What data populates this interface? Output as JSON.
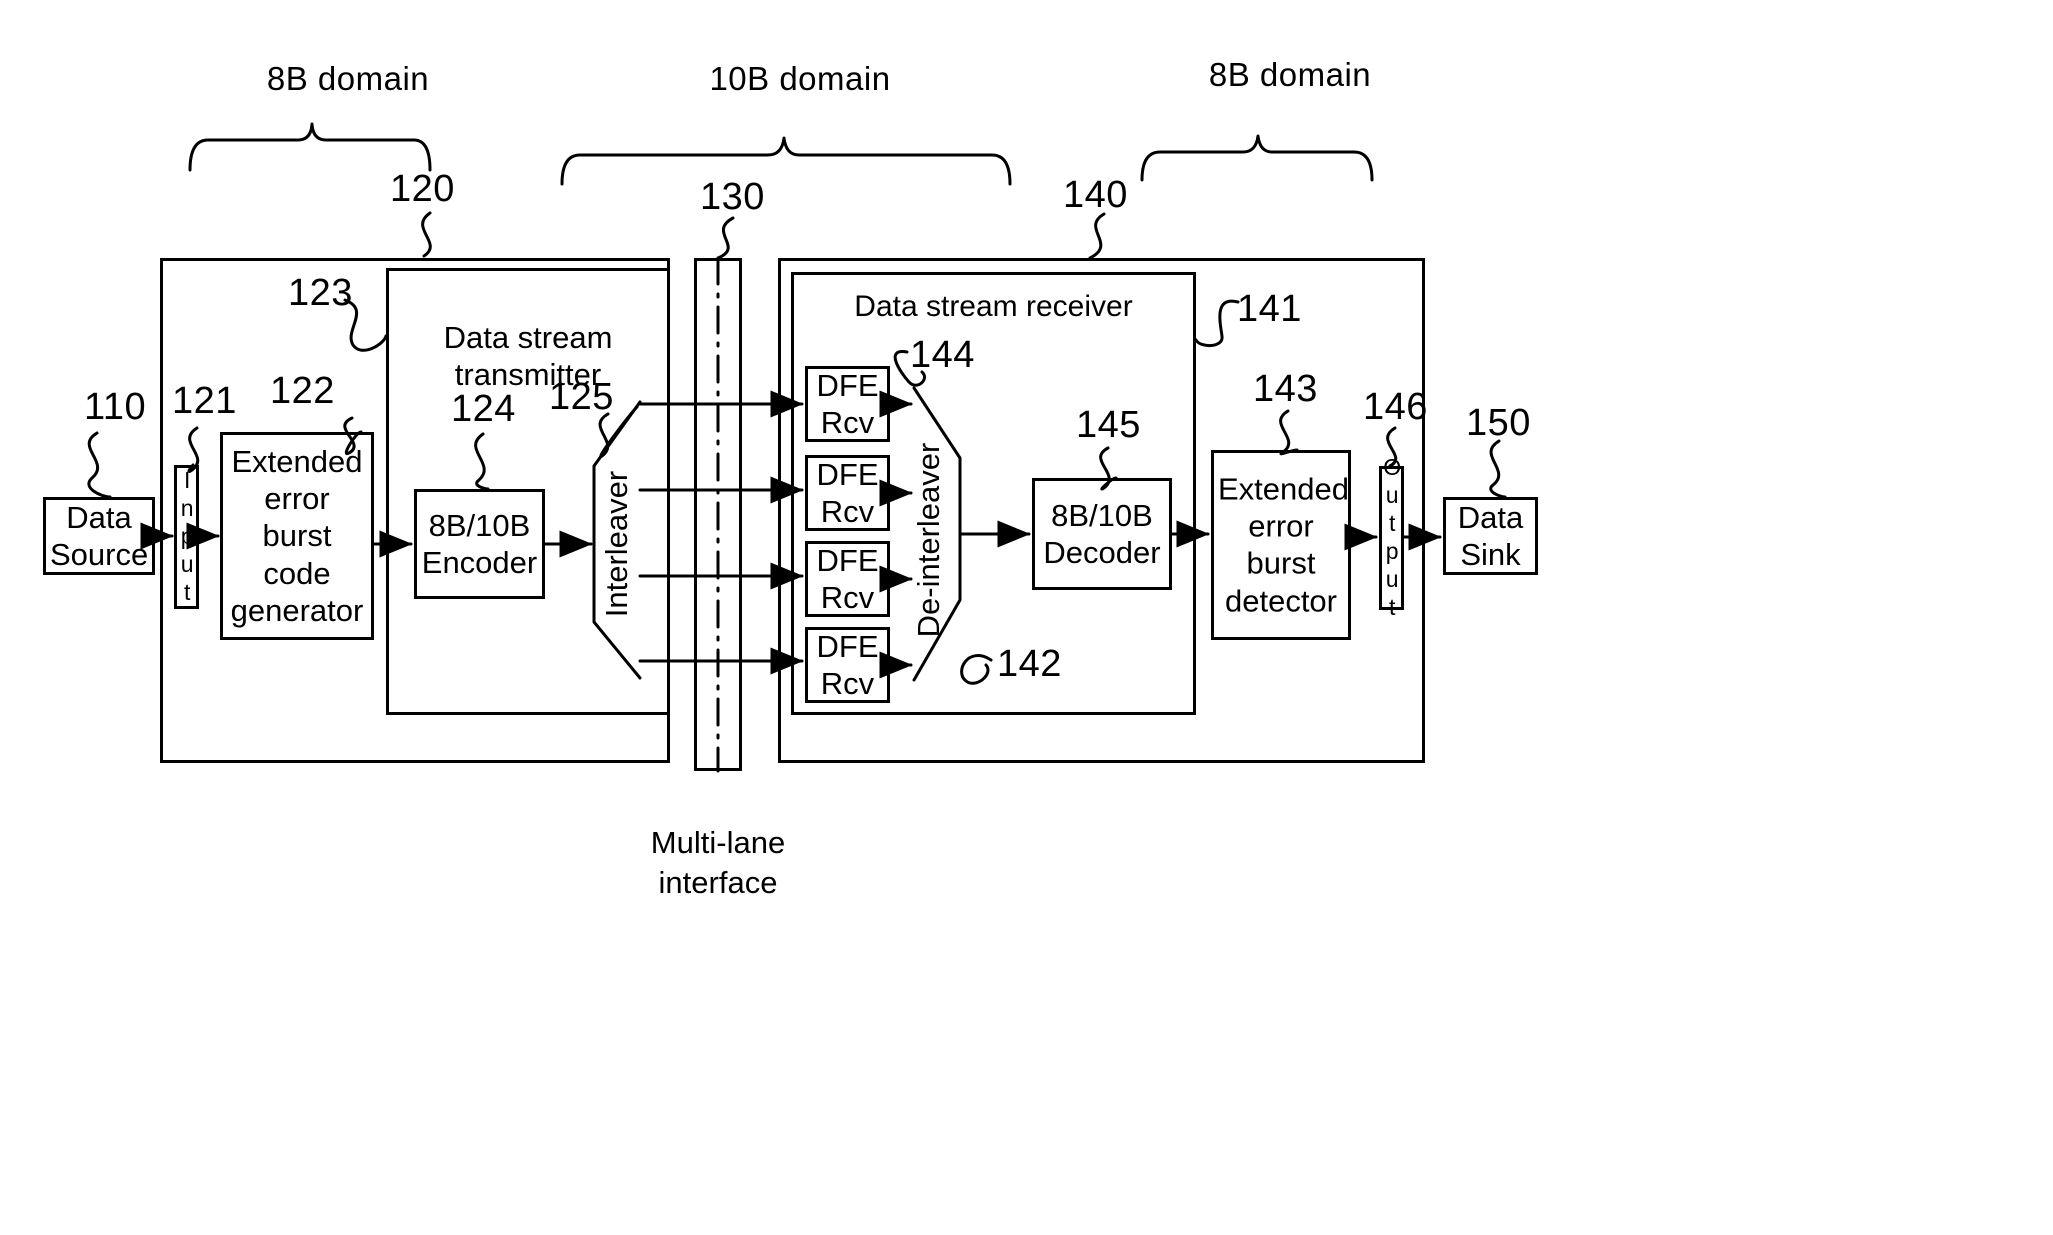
{
  "figure": {
    "domains": [
      {
        "label": "8B domain"
      },
      {
        "label": "10B domain"
      },
      {
        "label": "8B domain"
      }
    ],
    "reference_numerals": [
      {
        "id": "110",
        "text": "110"
      },
      {
        "id": "120",
        "text": "120"
      },
      {
        "id": "121",
        "text": "121"
      },
      {
        "id": "122",
        "text": "122"
      },
      {
        "id": "123",
        "text": "123"
      },
      {
        "id": "124",
        "text": "124"
      },
      {
        "id": "125",
        "text": "125"
      },
      {
        "id": "130",
        "text": "130"
      },
      {
        "id": "140",
        "text": "140"
      },
      {
        "id": "141",
        "text": "141"
      },
      {
        "id": "142",
        "text": "142"
      },
      {
        "id": "143",
        "text": "143"
      },
      {
        "id": "144",
        "text": "144"
      },
      {
        "id": "145",
        "text": "145"
      },
      {
        "id": "146",
        "text": "146"
      },
      {
        "id": "150",
        "text": "150"
      }
    ],
    "blocks": {
      "data_source": "Data\nSource",
      "input_port": "Input",
      "error_burst_code_generator": "Extended\nerror burst\ncode\ngenerator",
      "data_stream_transmitter": "Data stream\ntransmitter",
      "encoder": "8B/10B\nEncoder",
      "interleaver": "Interleaver",
      "data_stream_receiver": "Data stream receiver",
      "dfe_rcv_1": "DFE\nRcv",
      "dfe_rcv_2": "DFE\nRcv",
      "dfe_rcv_3": "DFE\nRcv",
      "dfe_rcv_4": "DFE\nRcv",
      "deinterleaver": "De-interleaver",
      "decoder": "8B/10B\nDecoder",
      "error_burst_detector": "Extended\nerror burst\ndetector",
      "output_port": "Output",
      "data_sink": "Data\nSink"
    },
    "captions": {
      "multi_lane_interface": "Multi-lane\ninterface"
    },
    "colors": {
      "stroke": "#000000",
      "background": "#ffffff"
    }
  }
}
